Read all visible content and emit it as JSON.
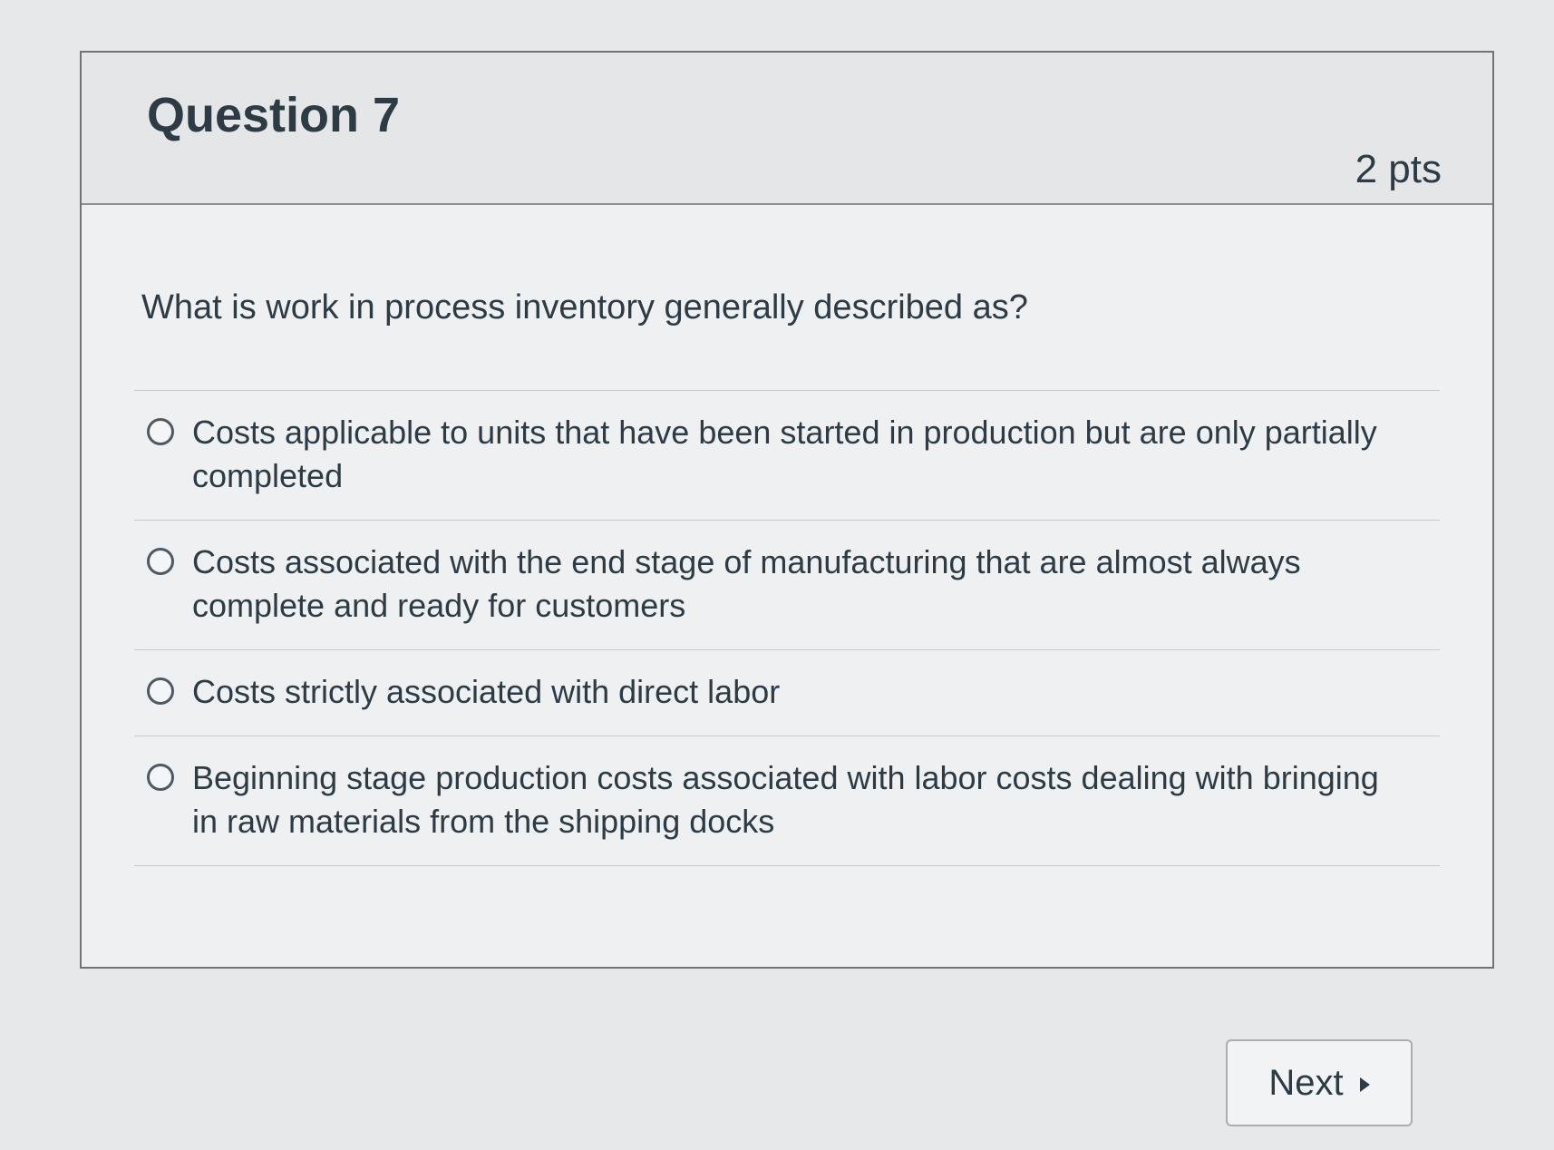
{
  "question": {
    "title": "Question 7",
    "points": "2 pts",
    "text": "What is work in process inventory generally described as?",
    "answers": [
      {
        "label": "Costs applicable to units that have been started in production but are only partially completed"
      },
      {
        "label": "Costs associated with the end stage of manufacturing that are almost always complete and ready for customers"
      },
      {
        "label": "Costs strictly associated with direct labor"
      },
      {
        "label": "Beginning stage production costs associated with labor costs dealing with bringing in raw materials from the shipping docks"
      }
    ]
  },
  "navigation": {
    "next_label": "Next",
    "next_icon": "caret-right-icon"
  }
}
